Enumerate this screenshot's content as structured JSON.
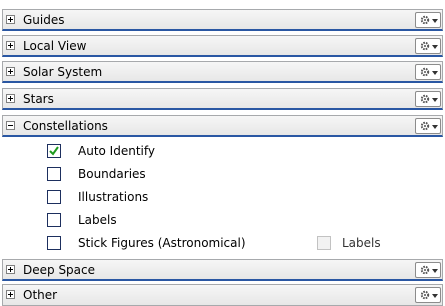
{
  "sections": [
    {
      "label": "Guides",
      "expanded": false
    },
    {
      "label": "Local View",
      "expanded": false
    },
    {
      "label": "Solar System",
      "expanded": false
    },
    {
      "label": "Stars",
      "expanded": false
    },
    {
      "label": "Constellations",
      "expanded": true
    },
    {
      "label": "Deep Space",
      "expanded": false
    },
    {
      "label": "Other",
      "expanded": false
    }
  ],
  "constellation_options": [
    {
      "label": "Auto Identify",
      "checked": true
    },
    {
      "label": "Boundaries",
      "checked": false
    },
    {
      "label": "Illustrations",
      "checked": false
    },
    {
      "label": "Labels",
      "checked": false
    },
    {
      "label": "Stick Figures (Astronomical)",
      "checked": false
    }
  ],
  "stick_figures_labels": {
    "label": "Labels",
    "checked": false,
    "enabled": false
  },
  "icons": {
    "expand": "plus-box-icon",
    "collapse": "minus-box-icon",
    "options": "gear-icon",
    "dropdown": "chevron-down-icon",
    "check": "checkmark-icon"
  },
  "colors": {
    "selected_border": "#2a57a3",
    "check_green": "#1e9a1e"
  }
}
